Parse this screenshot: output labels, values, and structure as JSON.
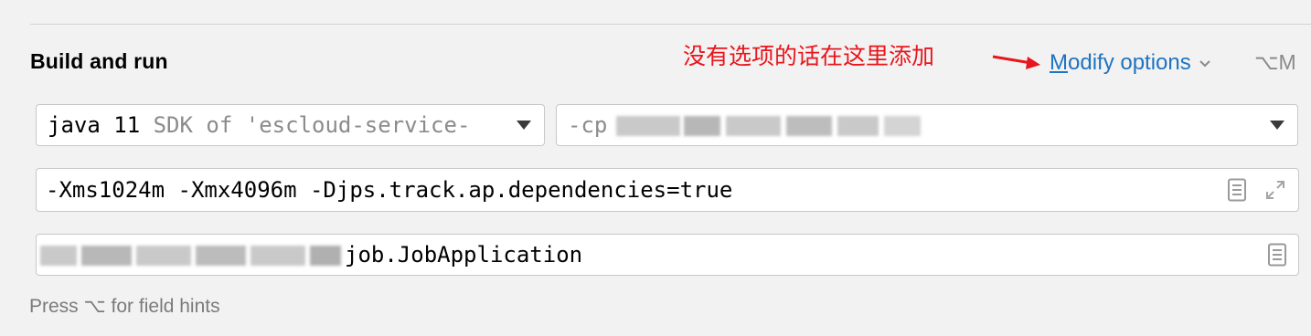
{
  "section": {
    "title": "Build and run"
  },
  "annotation": {
    "text": "没有选项的话在这里添加"
  },
  "modify_options": {
    "mnemonic": "M",
    "label_rest": "odify options",
    "shortcut": "⌥M",
    "color": "#2073c1"
  },
  "jdk_select": {
    "value": "java 11",
    "hint": "SDK of 'escloud-service-"
  },
  "classpath_select": {
    "prefix": "-cp"
  },
  "vm_options": {
    "value": "-Xms1024m -Xmx4096m -Djps.track.ap.dependencies=true"
  },
  "main_class": {
    "value_suffix": "job.JobApplication"
  },
  "footer": {
    "hint": "Press ⌥ for field hints"
  },
  "colors": {
    "annotation": "#e8151c",
    "link": "#2073c1",
    "background": "#f2f2f2"
  },
  "icons": [
    "chevron-down-icon",
    "dropdown-arrow-icon",
    "document-icon",
    "expand-icon",
    "arrow-annotation-icon"
  ]
}
